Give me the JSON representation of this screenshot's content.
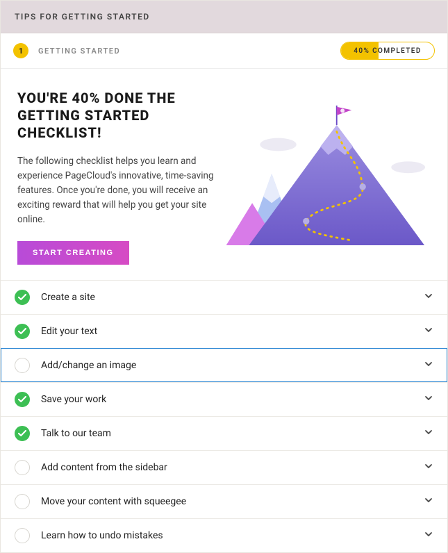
{
  "topbar": {
    "title": "TIPS FOR GETTING STARTED"
  },
  "step": {
    "number": "1",
    "label": "GETTING STARTED"
  },
  "progress": {
    "percent": 40,
    "label": "40% COMPLETED"
  },
  "hero": {
    "heading": "YOU'RE 40% DONE THE GETTING STARTED CHECKLIST!",
    "body": "The following checklist helps you learn and experience PageCloud's innovative, time-saving features. Once you're done, you will receive an exciting reward that will help you get your site online.",
    "cta": "START CREATING"
  },
  "checklist": [
    {
      "label": "Create a site",
      "done": true
    },
    {
      "label": "Edit your text",
      "done": true
    },
    {
      "label": "Add/change an image",
      "done": false,
      "selected": true
    },
    {
      "label": "Save your work",
      "done": true
    },
    {
      "label": "Talk to our team",
      "done": true
    },
    {
      "label": "Add content from the sidebar",
      "done": false
    },
    {
      "label": "Move your content with squeegee",
      "done": false
    },
    {
      "label": "Learn how to undo mistakes",
      "done": false
    }
  ]
}
